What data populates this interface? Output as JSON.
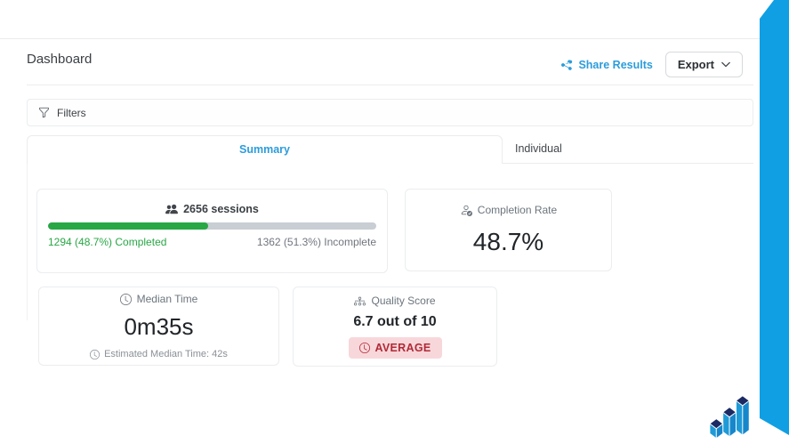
{
  "header": {
    "title": "Dashboard",
    "share_button": "Share Results",
    "export_button": "Export"
  },
  "filters": {
    "label": "Filters"
  },
  "tabs": {
    "summary": "Summary",
    "individual": "Individual",
    "active_tab": "Summary"
  },
  "summary": {
    "sessions": {
      "total_label": "2656 sessions",
      "completed_label": "1294 (48.7%) Completed",
      "incomplete_label": "1362 (51.3%) Incomplete",
      "completed_pct": 48.7,
      "incomplete_pct": 51.3
    },
    "completion_rate": {
      "label": "Completion Rate",
      "value": "48.7%"
    },
    "median_time": {
      "label": "Median Time",
      "value": "0m35s",
      "estimate": "Estimated Median Time: 42s"
    },
    "quality_score": {
      "label": "Quality Score",
      "value": "6.7 out of 10",
      "badge": "AVERAGE"
    }
  },
  "icons": {
    "share": "share-nodes",
    "export_chevron": "chevron-down",
    "filters": "funnel",
    "sessions": "people",
    "completion_rate": "person-check",
    "median_time": "clock",
    "estimate": "clock",
    "quality_score": "diagram-3",
    "badge": "clock",
    "logo": "step-bars-3d"
  },
  "colors": {
    "accent_blue": "#2d9cdb",
    "ribbon_blue": "#109fe3",
    "success_green": "#28a745",
    "progress_track": "#c9ced4",
    "muted_text": "#6c757d",
    "dark_text": "#212529",
    "badge_bg": "#f8d7da",
    "badge_text": "#b02a37",
    "logo_navy": "#1b2a63",
    "logo_blue": "#1e9ad6"
  }
}
